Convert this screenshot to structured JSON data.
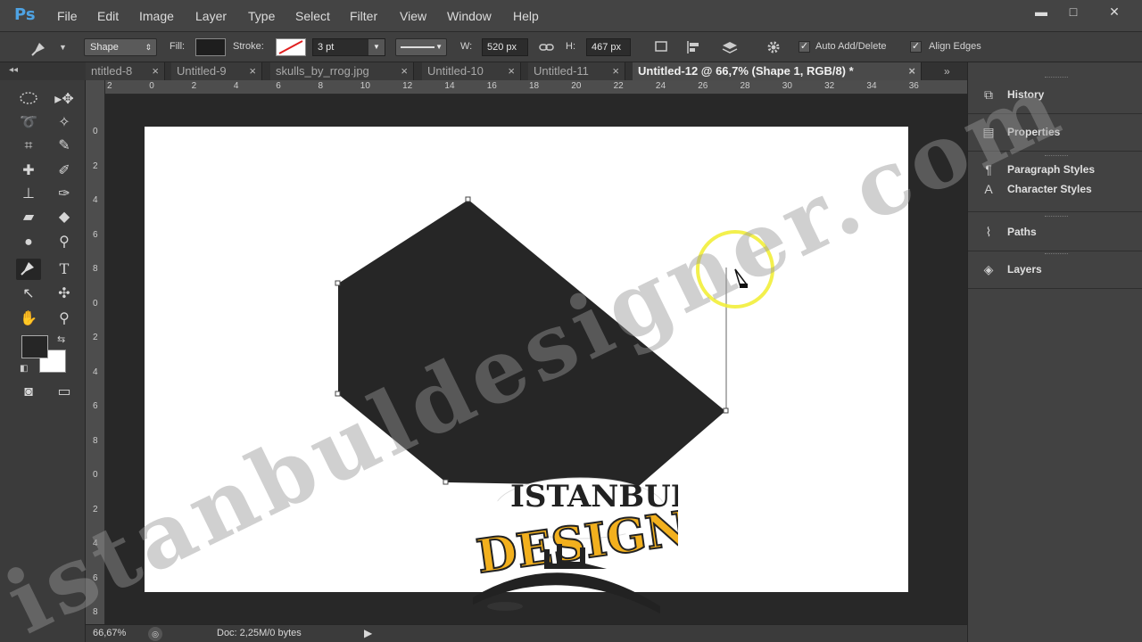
{
  "app": {
    "logo": "Ps"
  },
  "menu": [
    "File",
    "Edit",
    "Image",
    "Layer",
    "Type",
    "Select",
    "Filter",
    "View",
    "Window",
    "Help"
  ],
  "window_buttons": [
    "▬",
    "□",
    "✕"
  ],
  "options": {
    "tool_mode": "Shape",
    "fill_label": "Fill:",
    "stroke_label": "Stroke:",
    "stroke_width": "3 pt",
    "w_label": "W:",
    "w_value": "520 px",
    "h_label": "H:",
    "h_value": "467 px",
    "auto_add_delete": "Auto Add/Delete",
    "align_edges": "Align Edges"
  },
  "tabs": [
    {
      "label": "ntitled-8",
      "active": false
    },
    {
      "label": "Untitled-9",
      "active": false
    },
    {
      "label": "skulls_by_rrog.jpg",
      "active": false
    },
    {
      "label": "Untitled-10",
      "active": false
    },
    {
      "label": "Untitled-11",
      "active": false
    },
    {
      "label": "Untitled-12 @ 66,7% (Shape 1, RGB/8) *",
      "active": true
    }
  ],
  "ruler_top": [
    "2",
    "0",
    "2",
    "4",
    "6",
    "8",
    "10",
    "12",
    "14",
    "16",
    "18",
    "20",
    "22",
    "24",
    "26",
    "28",
    "30",
    "32",
    "34",
    "36"
  ],
  "ruler_left": [
    "0",
    "2",
    "4",
    "6",
    "8",
    "0",
    "2",
    "4",
    "6",
    "8",
    "0",
    "2",
    "4",
    "6",
    "8",
    "2"
  ],
  "status": {
    "zoom": "66,67%",
    "doc": "Doc: 2,25M/0 bytes"
  },
  "panels": [
    {
      "label": "History",
      "icon": "history-icon"
    },
    {
      "label": "Properties",
      "icon": "properties-icon"
    },
    {
      "label": "Paragraph Styles",
      "icon": "paragraph-styles-icon"
    },
    {
      "label": "Character Styles",
      "icon": "character-styles-icon"
    },
    {
      "label": "Paths",
      "icon": "paths-icon"
    },
    {
      "label": "Layers",
      "icon": "layers-icon"
    }
  ],
  "watermark": {
    "text": "istanbuldesigner.com",
    "logo_line1": "ISTANBUL",
    "logo_line2": "DESIGNER"
  },
  "colors": {
    "shape": "#262626",
    "foreground": "#262626",
    "background": "#ffffff",
    "cursor_ring": "#f2ee3a",
    "logo_yellow": "#f2b01e"
  }
}
